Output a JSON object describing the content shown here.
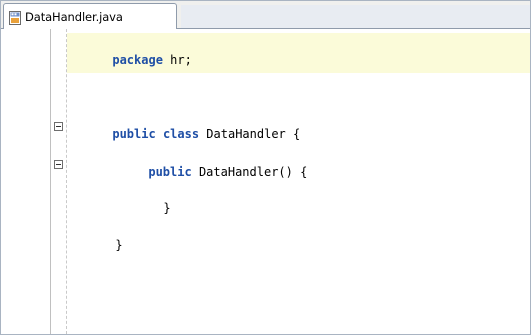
{
  "tab": {
    "label": "DataHandler.java",
    "icon": "java-file-icon"
  },
  "code": {
    "line1": {
      "keyword": "package",
      "rest": " hr;"
    },
    "line2": {
      "keyword1": "public",
      "mid": " ",
      "keyword2": "class",
      "rest": " DataHandler {"
    },
    "line3": {
      "keyword": "public",
      "rest": " DataHandler() {"
    },
    "line4": {
      "text": "}"
    },
    "line5": {
      "text": "}"
    }
  },
  "colors": {
    "keyword": "#1f4fa6",
    "current_line": "#fbfbd9",
    "tab_border": "#8f9bab"
  }
}
